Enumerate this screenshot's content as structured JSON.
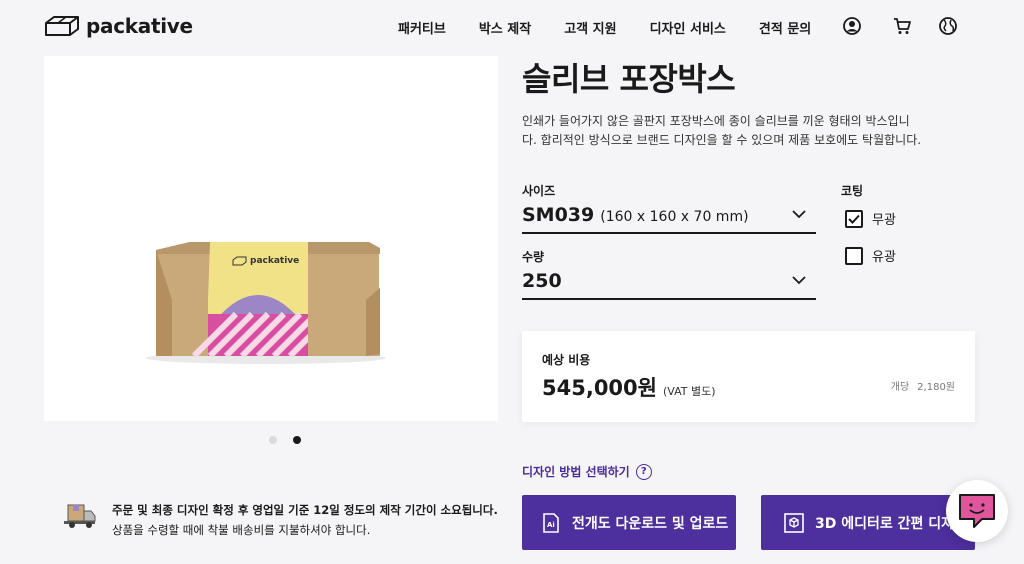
{
  "header": {
    "logo_text": "packative",
    "nav": [
      "패커티브",
      "박스 제작",
      "고객 지원",
      "디자인 서비스",
      "견적 문의"
    ],
    "icons": [
      "user-icon",
      "cart-icon",
      "globe-icon"
    ]
  },
  "product": {
    "title": "슬리브 포장박스",
    "description": "인쇄가 들어가지 않은 골판지 포장박스에 종이 슬리브를 끼운 형태의 박스입니다. 합리적인 방식으로 브랜드 디자인을 할 수 있으며 제품 보호에도 탁월합니다.",
    "image_logo_text": "packative",
    "gallery_dots": 2,
    "gallery_active_index": 1
  },
  "options": {
    "size_label": "사이즈",
    "size_code": "SM039",
    "size_dims": "(160 x 160 x 70 mm)",
    "qty_label": "수량",
    "qty_value": "250",
    "coating_label": "코팅",
    "coating_options": [
      {
        "label": "무광",
        "checked": true
      },
      {
        "label": "유광",
        "checked": false
      }
    ]
  },
  "price": {
    "label": "예상 비용",
    "value": "545,000원",
    "vat": "(VAT 별도)",
    "unit_label": "개당",
    "unit_value": "2,180원"
  },
  "design": {
    "method_label": "디자인 방법 선택하기",
    "help": "?",
    "btn_upload": "전개도 다운로드 및 업로드",
    "btn_editor": "3D 에디터로 간편 디자인"
  },
  "shipping": {
    "line1": "주문 및 최종 디자인 확정 후 영업일 기준 12일 정도의 제작 기간이 소요됩니다.",
    "line2": "상품을 수령할 때에 착불 배송비를 지불하셔야 합니다."
  },
  "colors": {
    "accent": "#4d2f9d",
    "text": "#1a1a1a",
    "background": "#f5f5f7",
    "chat_pink": "#e0559b"
  }
}
